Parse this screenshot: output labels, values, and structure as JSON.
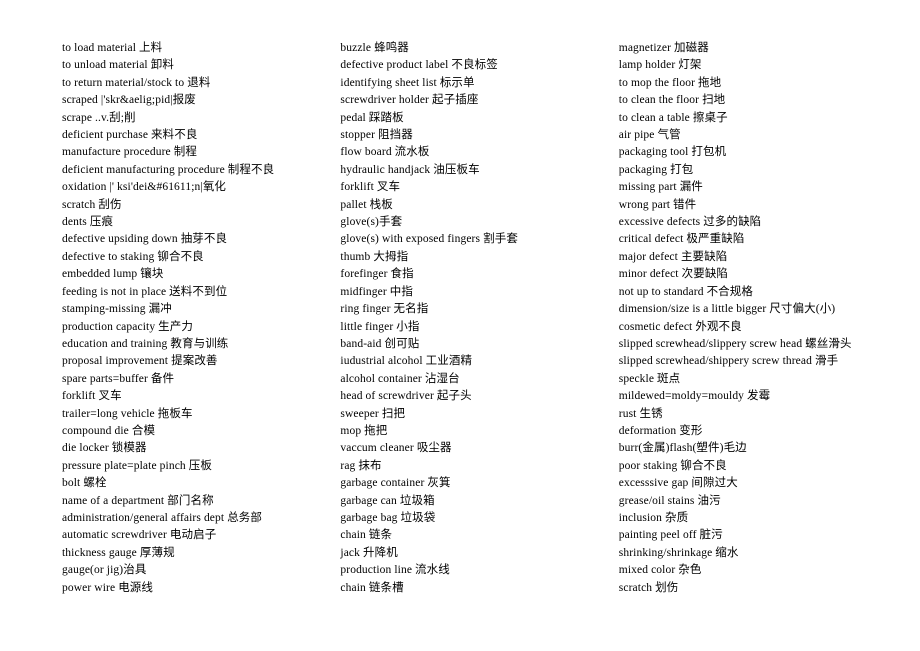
{
  "document": {
    "kind": "bilingual-glossary",
    "background_color": "#ffffff",
    "text_color": "#000000",
    "column_count": 3
  },
  "columns": [
    {
      "name": "column-1",
      "entries": [
        "to load material 上料",
        "to unload material 卸料",
        "to return material/stock to 退料",
        "scraped |'skr&aelig;pid|报废",
        "scrape ..v.刮;削",
        "deficient purchase 来料不良",
        "manufacture procedure 制程",
        "deficient manufacturing procedure 制程不良",
        "oxidation |' ksi'dei&#61611;n|氧化",
        "scratch 刮伤",
        "dents 压痕",
        "defective upsiding down 抽芽不良",
        "defective to staking 铆合不良",
        "embedded lump 镶块",
        "feeding is not in place 送料不到位",
        "stamping-missing 漏冲",
        "production capacity 生产力",
        "education and training 教育与训练",
        "proposal improvement 提案改善",
        "spare parts=buffer 备件",
        "forklift 叉车",
        "trailer=long vehicle 拖板车",
        "compound die 合模",
        "die locker 锁模器",
        "pressure plate=plate pinch 压板",
        "bolt 螺栓",
        "name of a department 部门名称",
        "administration/general affairs dept 总务部",
        "automatic screwdriver 电动启子",
        "thickness gauge 厚薄规",
        "gauge(or jig)治具",
        "power wire 电源线"
      ]
    },
    {
      "name": "column-2",
      "entries": [
        "buzzle 蜂鸣器",
        "defective product label 不良标签",
        "identifying sheet list 标示单",
        "screwdriver holder 起子插座",
        "pedal 踩踏板",
        "stopper 阻挡器",
        "flow board 流水板",
        "hydraulic handjack 油压板车",
        "forklift 叉车",
        "pallet 栈板",
        "glove(s)手套",
        "glove(s) with exposed fingers 割手套",
        "thumb 大拇指",
        "forefinger 食指",
        "midfinger 中指",
        "ring finger 无名指",
        "little finger 小指",
        "band-aid 创可贴",
        "iudustrial alcohol 工业酒精",
        "alcohol container 沾湿台",
        "head of screwdriver 起子头",
        "sweeper 扫把",
        "mop 拖把",
        "vaccum cleaner 吸尘器",
        "rag 抹布",
        "garbage container 灰箕",
        "garbage can 垃圾箱",
        "garbage bag 垃圾袋",
        "chain 链条",
        "jack 升降机",
        "production line 流水线",
        "chain 链条槽"
      ]
    },
    {
      "name": "column-3",
      "entries": [
        "magnetizer 加磁器",
        "lamp holder 灯架",
        "to mop the floor 拖地",
        "to clean the floor 扫地",
        "to clean a table 擦桌子",
        "air pipe 气管",
        "packaging tool 打包机",
        "packaging 打包",
        "missing part 漏件",
        "wrong part 错件",
        "excessive defects 过多的缺陷",
        "critical defect 极严重缺陷",
        "major defect 主要缺陷",
        "minor defect 次要缺陷",
        "not up to standard 不合规格",
        "dimension/size is a little bigger 尺寸偏大(小)",
        "cosmetic defect 外观不良",
        "slipped screwhead/slippery screw head 螺丝滑头",
        "slipped screwhead/shippery screw thread 滑手",
        "speckle 斑点",
        "mildewed=moldy=mouldy 发霉",
        "rust 生锈",
        "deformation 变形",
        "burr(金属)flash(塑件)毛边",
        "poor staking 铆合不良",
        "excesssive gap 间隙过大",
        "grease/oil stains 油污",
        "inclusion 杂质",
        "painting peel off 脏污",
        "shrinking/shrinkage 缩水",
        "mixed color 杂色",
        "scratch 划伤"
      ]
    }
  ]
}
